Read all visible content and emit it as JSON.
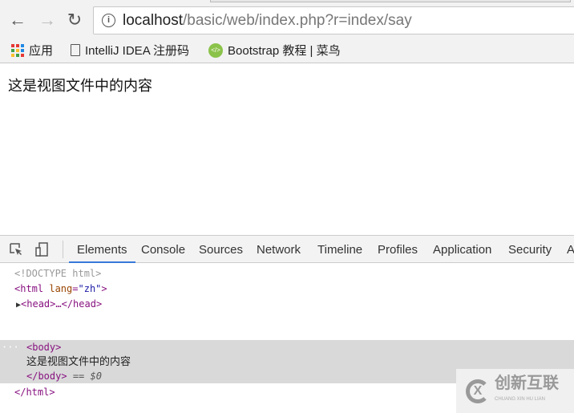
{
  "browser": {
    "url_host": "localhost",
    "url_path": "/basic/web/index.php?r=index/say",
    "bookmarks": [
      {
        "label": "应用",
        "icon": "apps-grid-icon"
      },
      {
        "label": "IntelliJ IDEA 注册码",
        "icon": "document-icon"
      },
      {
        "label": "Bootstrap 教程 | 菜鸟",
        "icon": "bootstrap-icon"
      }
    ]
  },
  "page": {
    "content": "这是视图文件中的内容"
  },
  "devtools": {
    "tabs": [
      "Elements",
      "Console",
      "Sources",
      "Network",
      "Timeline",
      "Profiles",
      "Application",
      "Security",
      "A"
    ],
    "active_tab": "Elements",
    "dom": {
      "doctype": "<!DOCTYPE html>",
      "html_open": "<html",
      "lang_attr": "lang",
      "lang_value": "\"zh\"",
      "head": "<head>…</head>",
      "body_open": "<body>",
      "body_text": "这是视图文件中的内容",
      "body_close": "</body>",
      "selected_marker": "== $0",
      "html_close": "</html>",
      "ellipsis": "···"
    }
  },
  "watermark": {
    "text": "创新互联",
    "subtext": "CHUANG XIN HU LIAN"
  }
}
